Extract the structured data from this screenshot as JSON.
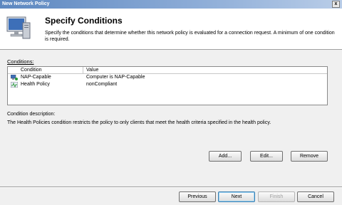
{
  "window": {
    "title": "New Network Policy",
    "close_glyph": "x"
  },
  "header": {
    "title": "Specify Conditions",
    "description": "Specify the conditions that determine whether this network policy is evaluated for a connection request. A minimum of one condition is required.",
    "icon": "computer-monitor-icon"
  },
  "conditions": {
    "label": "Conditions:",
    "columns": [
      "Condition",
      "Value"
    ],
    "rows": [
      {
        "condition": "NAP-Capable",
        "value": "Computer is NAP-Capable",
        "icon": "nap-capable-icon"
      },
      {
        "condition": "Health Policy",
        "value": "nonCompliant",
        "icon": "health-policy-icon"
      }
    ]
  },
  "description": {
    "label": "Condition description:",
    "text": "The Health Policies condition restricts the policy to only clients that meet the health criteria specified in the health policy."
  },
  "buttons": {
    "add": "Add...",
    "edit": "Edit...",
    "remove": "Remove",
    "previous": "Previous",
    "next": "Next",
    "finish": "Finish",
    "cancel": "Cancel"
  }
}
